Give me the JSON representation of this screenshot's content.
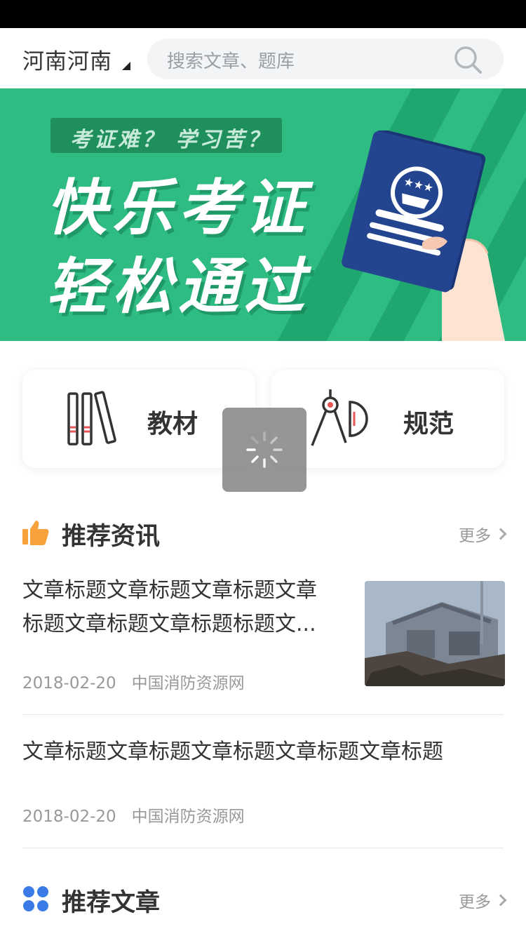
{
  "header": {
    "region_label": "河南河南",
    "search_placeholder": "搜索文章、题库"
  },
  "banner": {
    "tag": "考证难？ 学习苦？",
    "line1": "快乐考证",
    "line2": "轻松通过"
  },
  "categories": [
    {
      "label": "教材",
      "icon": "books-icon"
    },
    {
      "label": "规范",
      "icon": "drafting-tools-icon"
    }
  ],
  "loading": {
    "icon": "loading-spinner-icon"
  },
  "news_section": {
    "title": "推荐资讯",
    "icon": "thumbs-up-icon",
    "more_label": "更多",
    "articles": [
      {
        "title_line1": "文章标题文章标题文章标题文章",
        "title_line2": "标题文章标题文章标题标题文...",
        "date": "2018-02-20",
        "source": "中国消防资源网",
        "has_thumbnail": true
      },
      {
        "title_line1": "文章标题文章标题文章标题文章标题文章标题",
        "date": "2018-02-20",
        "source": "中国消防资源网",
        "has_thumbnail": false
      }
    ]
  },
  "article_section": {
    "title": "推荐文章",
    "icon": "grid-dots-icon",
    "more_label": "更多"
  },
  "colors": {
    "banner_green": "#2ebc83",
    "accent_orange": "#f7a23b",
    "accent_blue": "#3b7be8",
    "passport_blue": "#23448f"
  }
}
